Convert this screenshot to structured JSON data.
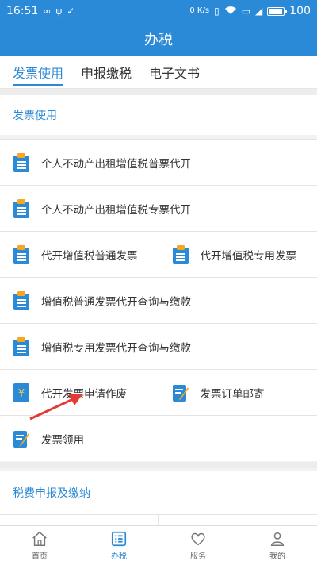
{
  "status": {
    "time": "16:51",
    "net_speed": "0 K/s",
    "battery_percent": "100",
    "battery_level": 1.0
  },
  "header": {
    "title": "办税"
  },
  "tabs": [
    {
      "label": "发票使用",
      "active": true
    },
    {
      "label": "申报缴税",
      "active": false
    },
    {
      "label": "电子文书",
      "active": false
    }
  ],
  "sections": {
    "invoice": {
      "title": "发票使用"
    },
    "tax": {
      "title": "税费申报及缴纳"
    }
  },
  "invoice_items": {
    "i1": {
      "label": "个人不动产出租增值税普票代开",
      "icon": "clipboard-icon"
    },
    "i2": {
      "label": "个人不动产出租增值税专票代开",
      "icon": "clipboard-icon"
    },
    "i3": {
      "label": "代开增值税普通发票",
      "icon": "clipboard-icon"
    },
    "i4": {
      "label": "代开增值税专用发票",
      "icon": "clipboard-icon"
    },
    "i5": {
      "label": "增值税普通发票代开查询与缴款",
      "icon": "clipboard-icon"
    },
    "i6": {
      "label": "增值税专用发票代开查询与缴款",
      "icon": "clipboard-icon"
    },
    "i7": {
      "label": "代开发票申请作废",
      "icon": "yuan-document-icon"
    },
    "i8": {
      "label": "发票订单邮寄",
      "icon": "edit-document-icon"
    },
    "i9": {
      "label": "发票领用",
      "icon": "edit-document-icon"
    }
  },
  "tabbar": [
    {
      "label": "首页",
      "icon": "home-icon",
      "active": false
    },
    {
      "label": "办税",
      "icon": "list-icon",
      "active": true
    },
    {
      "label": "服务",
      "icon": "heart-icon",
      "active": false
    },
    {
      "label": "我的",
      "icon": "person-icon",
      "active": false
    }
  ],
  "colors": {
    "brand": "#2b8ad8",
    "arrow": "#e53935"
  }
}
